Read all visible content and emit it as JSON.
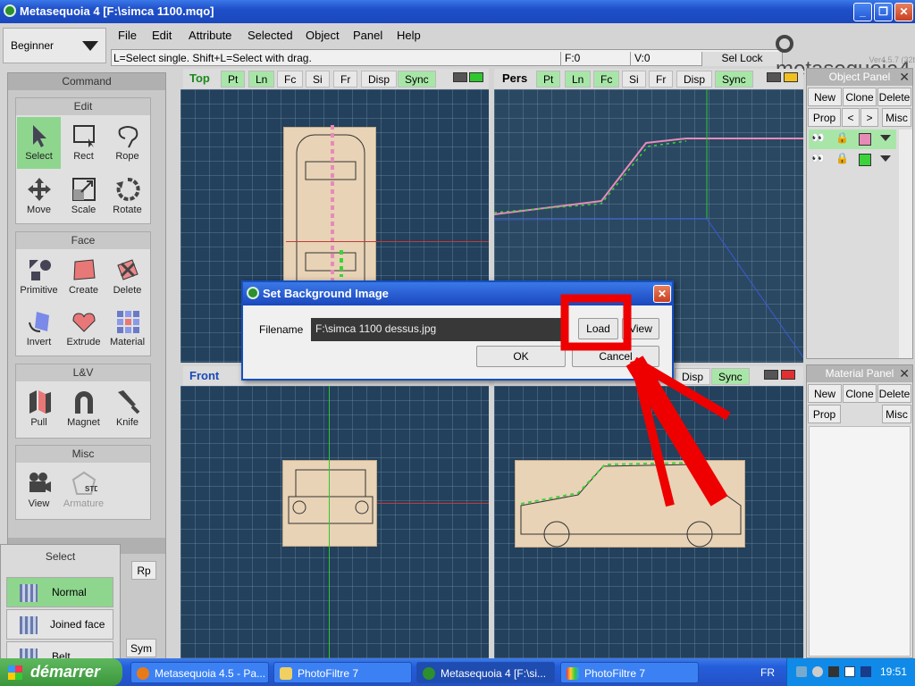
{
  "window": {
    "title": "Metasequoia 4 [F:\\simca 1100.mqo]"
  },
  "mode_select": {
    "value": "Beginner"
  },
  "menu": [
    "File",
    "Edit",
    "Attribute",
    "Selected",
    "Object",
    "Panel",
    "Help"
  ],
  "status": {
    "hint": "L=Select single.  Shift+L=Select with drag.",
    "face": "F:0",
    "vertex": "V:0",
    "sel_lock": "Sel Lock"
  },
  "logo": {
    "name": "metasequoia4",
    "version": "Ver4.5.7 (32bit)"
  },
  "command_panel": {
    "title": "Command",
    "sections": [
      {
        "label": "Edit",
        "tools": [
          "Select",
          "Rect",
          "Rope",
          "Move",
          "Scale",
          "Rotate"
        ]
      },
      {
        "label": "Face",
        "tools": [
          "Primitive",
          "Create",
          "Delete",
          "Invert",
          "Extrude",
          "Material"
        ]
      },
      {
        "label": "L&V",
        "tools": [
          "Pull",
          "Magnet",
          "Knife"
        ]
      },
      {
        "label": "Misc",
        "tools": [
          "View",
          "Armature"
        ]
      }
    ],
    "extra_buttons": [
      "Rp",
      "Sym"
    ]
  },
  "select_panel": {
    "title": "Select",
    "items": [
      "Normal",
      "Joined face",
      "Belt"
    ]
  },
  "viewports": {
    "top": {
      "label": "Top",
      "buttons": [
        "Pt",
        "Ln",
        "Fc",
        "Si",
        "Fr",
        "Disp",
        "Sync"
      ]
    },
    "pers": {
      "label": "Pers",
      "buttons": [
        "Pt",
        "Ln",
        "Fc",
        "Si",
        "Fr",
        "Disp",
        "Sync"
      ]
    },
    "front": {
      "label": "Front",
      "buttons": [
        "Disp",
        "Sync"
      ]
    }
  },
  "object_panel": {
    "title": "Object Panel",
    "buttons": [
      "New",
      "Clone",
      "Delete",
      "Prop",
      "<",
      ">",
      "Misc"
    ],
    "object_colors": [
      "#e88ab8",
      "#3ad43a"
    ]
  },
  "material_panel": {
    "title": "Material Panel",
    "buttons": [
      "New",
      "Clone",
      "Delete",
      "Prop",
      "Misc"
    ]
  },
  "dialog": {
    "title": "Set Background Image",
    "filename_label": "Filename",
    "filename_value": "F:\\simca 1100 dessus.jpg",
    "load": "Load",
    "view": "View",
    "ok": "OK",
    "cancel": "Cancel"
  },
  "taskbar": {
    "start": "démarrer",
    "tasks": [
      "Metasequoia 4.5 - Pa...",
      "PhotoFiltre 7",
      "Metasequoia 4 [F:\\si...",
      "PhotoFiltre 7"
    ],
    "lang": "FR",
    "clock": "19:51"
  }
}
